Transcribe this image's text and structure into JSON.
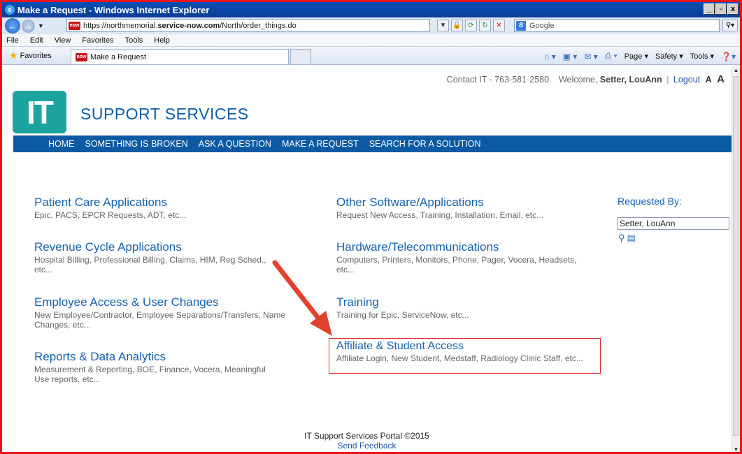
{
  "browser": {
    "window_title": "Make a Request - Windows Internet Explorer",
    "url_host": "https://northmemorial.",
    "url_domain": "service-now.com",
    "url_path": "/North/order_things.do",
    "search_placeholder": "Google",
    "menu": [
      "File",
      "Edit",
      "View",
      "Favorites",
      "Tools",
      "Help"
    ],
    "favorites_label": "Favorites",
    "tab_title": "Make a Request",
    "command_bar": {
      "page": "Page ▾",
      "safety": "Safety ▾",
      "tools": "Tools ▾"
    },
    "favicon_text": "now"
  },
  "header": {
    "contact": "Contact IT - 763-581-2580",
    "welcome": "Welcome,",
    "user": "Setter, LouAnn",
    "separator": "|",
    "logout": "Logout",
    "text_small": "A",
    "text_large": "A",
    "logo_text": "IT",
    "brand": "SUPPORT SERVICES"
  },
  "nav": {
    "items": [
      "HOME",
      "SOMETHING IS BROKEN",
      "ASK A QUESTION",
      "MAKE A REQUEST",
      "SEARCH FOR A SOLUTION"
    ]
  },
  "categories": {
    "left": [
      {
        "title": "Patient Care Applications",
        "desc": "Epic, PACS, EPCR Requests, ADT, etc..."
      },
      {
        "title": "Revenue Cycle Applications",
        "desc": "Hospital Billing, Professional Billing, Claims, HIM, Reg Sched., etc..."
      },
      {
        "title": "Employee Access & User Changes",
        "desc": "New Employee/Contractor, Employee Separations/Transfers, Name Changes, etc..."
      },
      {
        "title": "Reports & Data Analytics",
        "desc": "Measurement & Reporting, BOE, Finance, Vocera, Meaningful Use reports, etc..."
      }
    ],
    "right": [
      {
        "title": "Other Software/Applications",
        "desc": "Request New Access, Training, Installation, Email, etc..."
      },
      {
        "title": "Hardware/Telecommunications",
        "desc": "Computers, Printers, Monitors, Phone, Pager, Vocera, Headsets, etc..."
      },
      {
        "title": "Training",
        "desc": "Training for Epic, ServiceNow, etc..."
      },
      {
        "title": "Affiliate & Student Access",
        "desc": "Affiliate Login, New Student, Medstaff, Radiology Clinic Staff, etc..."
      }
    ]
  },
  "requested_by": {
    "label": "Requested By:",
    "value": "Setter, LouAnn"
  },
  "footer": {
    "copyright": "IT Support Services Portal ©2015",
    "feedback": "Send Feedback"
  },
  "colors": {
    "brand_blue": "#0b5aa3",
    "link_blue": "#1662ad",
    "logo_teal": "#1ba49f",
    "annotation_red": "#e12a2a"
  }
}
